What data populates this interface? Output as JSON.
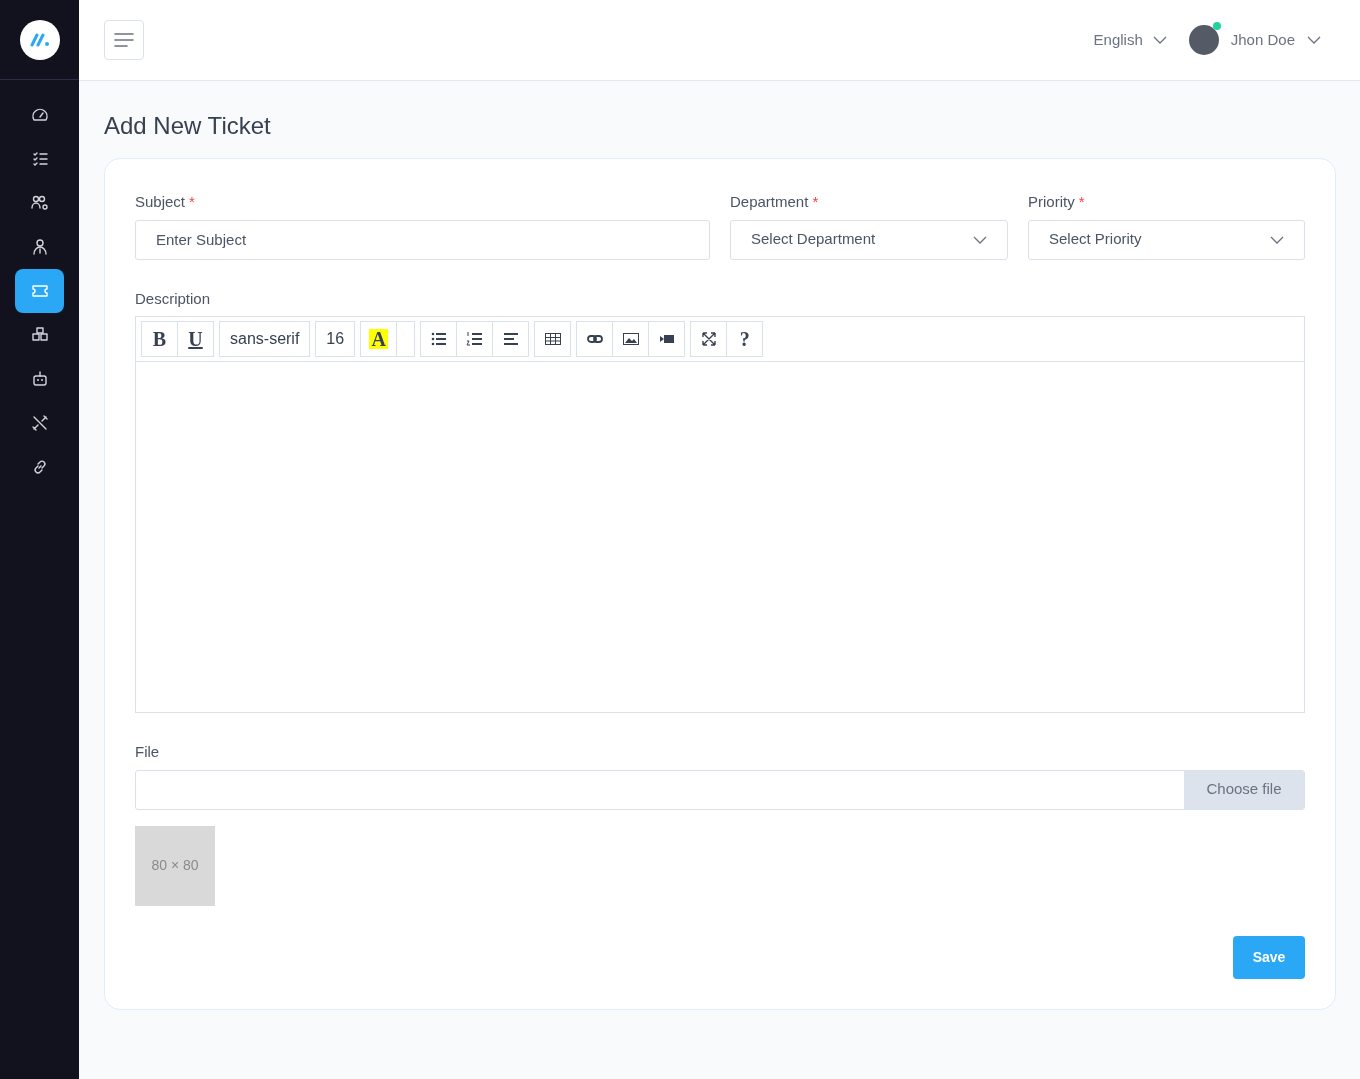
{
  "sidebar": {
    "items": [
      {
        "kind": "gauge",
        "selected": false
      },
      {
        "kind": "checklist",
        "selected": false
      },
      {
        "kind": "users-gear",
        "selected": false
      },
      {
        "kind": "user",
        "selected": false
      },
      {
        "kind": "ticket",
        "selected": true
      },
      {
        "kind": "boxes",
        "selected": false
      },
      {
        "kind": "robot",
        "selected": false
      },
      {
        "kind": "tools",
        "selected": false
      },
      {
        "kind": "link",
        "selected": false
      }
    ]
  },
  "header": {
    "language": "English",
    "user": {
      "name": "Jhon Doe",
      "online": true
    }
  },
  "page_title": "Add New Ticket",
  "form": {
    "subject": {
      "label": "Subject",
      "required_mark": "*",
      "placeholder": "Enter Subject"
    },
    "department": {
      "label": "Department",
      "required_mark": "*",
      "placeholder": "Select Department"
    },
    "priority": {
      "label": "Priority",
      "required_mark": "*",
      "placeholder": "Select Priority"
    },
    "description": {
      "label": "Description",
      "toolbar": [
        [
          {
            "kind": "bold",
            "text": "B"
          },
          {
            "kind": "underline",
            "text": "U"
          }
        ],
        [
          {
            "kind": "font",
            "text": "sans-serif"
          }
        ],
        [
          {
            "kind": "size",
            "text": "16"
          }
        ],
        [
          {
            "kind": "highlight",
            "text": "A"
          },
          {
            "kind": "blank"
          }
        ],
        [
          {
            "kind": "ul"
          },
          {
            "kind": "ol"
          },
          {
            "kind": "align"
          }
        ],
        [
          {
            "kind": "table"
          }
        ],
        [
          {
            "kind": "link"
          },
          {
            "kind": "image"
          },
          {
            "kind": "video"
          }
        ],
        [
          {
            "kind": "fullscreen"
          },
          {
            "kind": "help",
            "text": "?"
          }
        ]
      ]
    },
    "file": {
      "label": "File",
      "button": "Choose file",
      "preview": "80 × 80"
    },
    "save": "Save"
  }
}
